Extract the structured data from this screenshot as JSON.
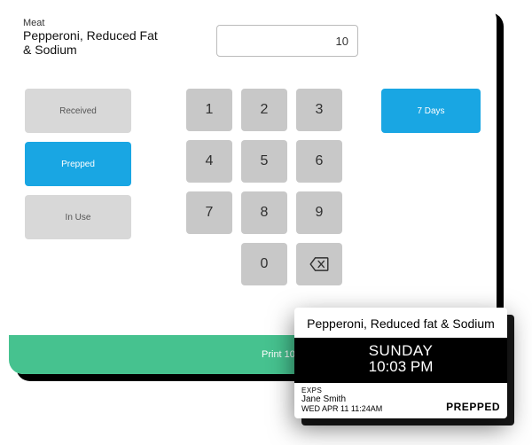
{
  "category": "Meat",
  "product_name": "Pepperoni, Reduced Fat & Sodium",
  "qty_value": "10",
  "status": {
    "received": "Received",
    "prepped": "Prepped",
    "inuse": "In Use"
  },
  "keypad": {
    "k1": "1",
    "k2": "2",
    "k3": "3",
    "k4": "4",
    "k5": "5",
    "k6": "6",
    "k7": "7",
    "k8": "8",
    "k9": "9",
    "k0": "0"
  },
  "shelf_life_button": "7 Days",
  "print_label": "Print 10",
  "label": {
    "title": "Pepperoni, Reduced fat & Sodium",
    "day": "SUNDAY",
    "time": "10:03 PM",
    "exps_label": "EXPS",
    "handler": "Jane Smith",
    "timestamp": "WED APR 11 11:24AM",
    "status": "PREPPED"
  },
  "colors": {
    "accent_blue": "#19a6e3",
    "accent_green": "#46c28f",
    "key_gray": "#c8c8c8",
    "btn_gray": "#d8d8d8"
  }
}
